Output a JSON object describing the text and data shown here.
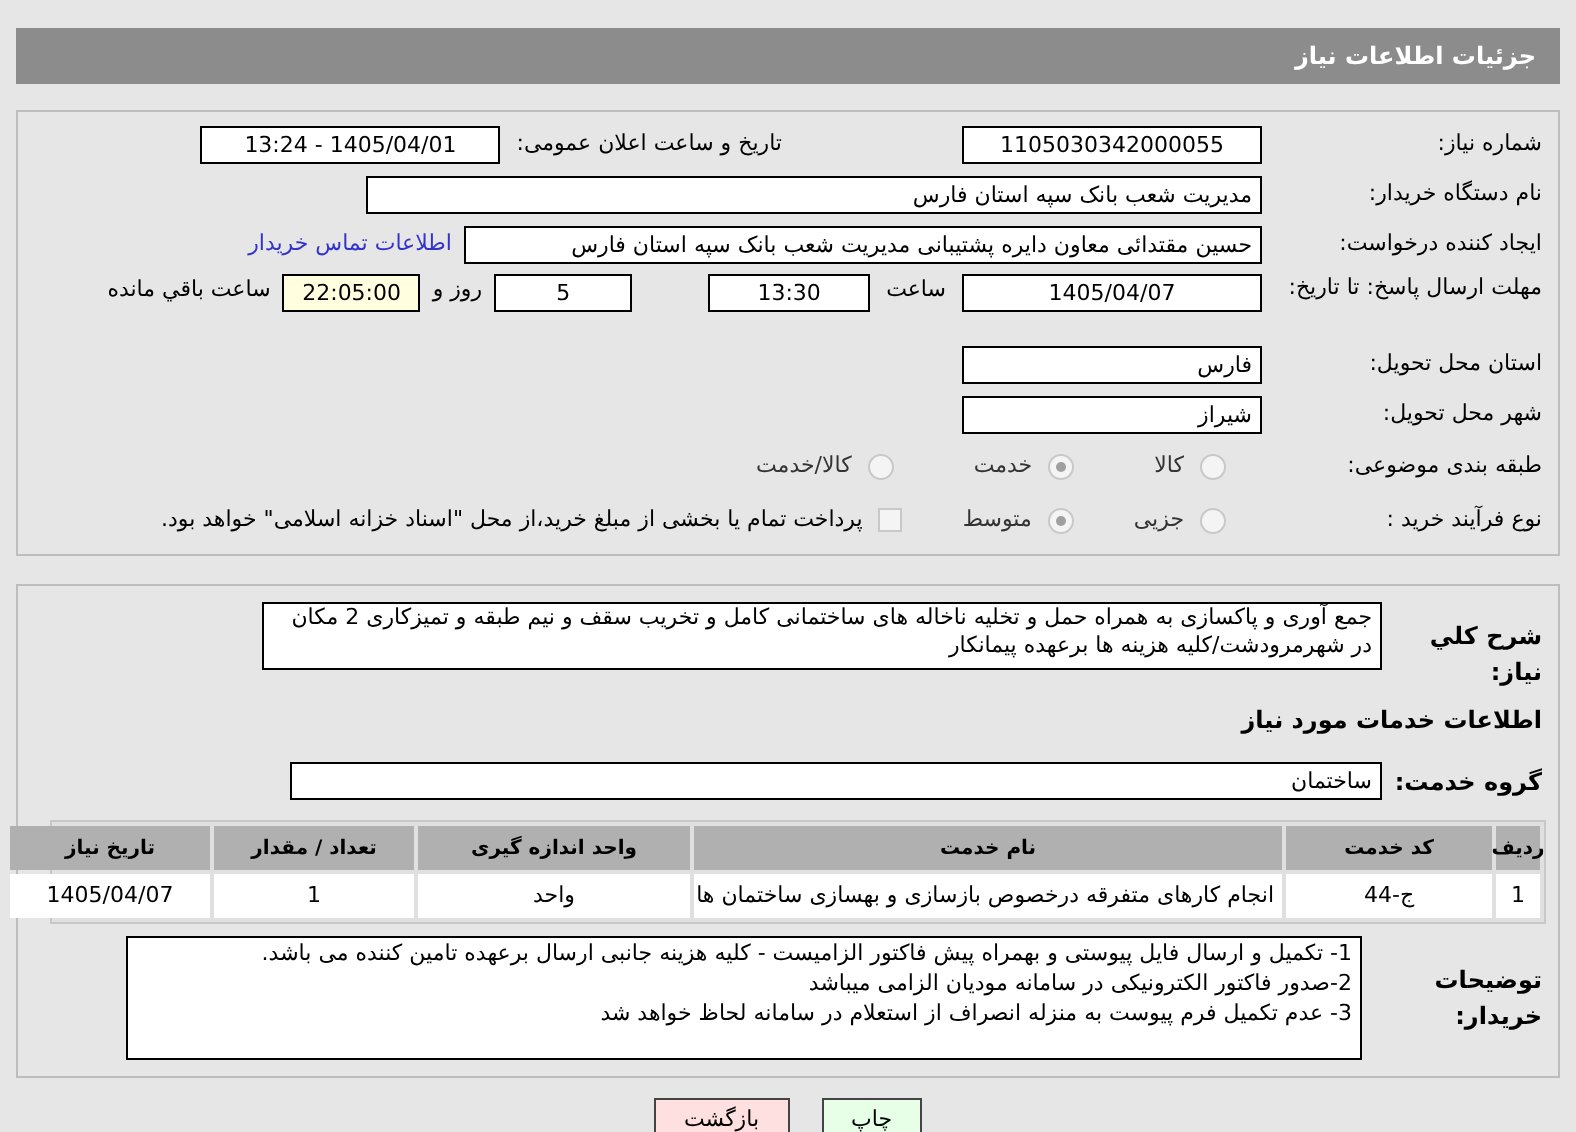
{
  "header": {
    "title": "جزئیات اطلاعات نیاز"
  },
  "need_number": {
    "label": "شماره نیاز:",
    "value": "1105030342000055"
  },
  "announce": {
    "label": "تاریخ و ساعت اعلان عمومی:",
    "value": "1405/04/01 - 13:24"
  },
  "buyer_org": {
    "label": "نام دستگاه خریدار:",
    "value": "مدیریت شعب بانک سپه استان فارس"
  },
  "requester": {
    "label": "ایجاد کننده درخواست:",
    "value": "حسین مقتدائی معاون  دایره پشتیبانی مدیریت شعب بانک سپه استان فارس",
    "link": "اطلاعات تماس خریدار"
  },
  "deadline": {
    "label": "مهلت ارسال پاسخ: تا تاریخ:",
    "date": "1405/04/07",
    "time_label": "ساعت",
    "time": "13:30",
    "days": "5",
    "days_label": "روز و",
    "remaining": "22:05:00",
    "remaining_label": "ساعت باقي مانده"
  },
  "province": {
    "label": "استان محل تحویل:",
    "value": "فارس"
  },
  "city": {
    "label": "شهر محل تحویل:",
    "value": "شیراز"
  },
  "category": {
    "label": "طبقه بندی موضوعی:",
    "options": [
      {
        "label": "کالا",
        "selected": false
      },
      {
        "label": "خدمت",
        "selected": true
      },
      {
        "label": "کالا/خدمت",
        "selected": false
      }
    ]
  },
  "process": {
    "label": "نوع فرآیند خرید :",
    "options": [
      {
        "label": "جزیی",
        "selected": false
      },
      {
        "label": "متوسط",
        "selected": true
      }
    ],
    "treasury": {
      "label": "پرداخت تمام یا بخشی از مبلغ خرید،از محل \"اسناد خزانه اسلامی\" خواهد بود.",
      "checked": false
    }
  },
  "description": {
    "label": "شرح کلي نياز:",
    "value": "جمع آوری و پاکسازی به همراه حمل و تخلیه ناخاله های ساختمانی کامل و تخریب سقف و نیم طبقه و تمیزکاری 2 مکان در شهرمرودشت/کلیه هزینه ها برعهده پیمانکار"
  },
  "services_heading": "اطلاعات خدمات مورد نیاز",
  "service_group": {
    "label": "گروه خدمت:",
    "value": "ساختمان"
  },
  "table": {
    "columns": [
      "ردیف",
      "کد خدمت",
      "نام خدمت",
      "واحد اندازه گیری",
      "تعداد / مقدار",
      "تاریخ نیاز"
    ],
    "rows": [
      [
        "1",
        "ج-44",
        "انجام کارهای متفرقه درخصوص بازسازی و بهسازی ساختمان ها",
        "واحد",
        "1",
        "1405/04/07"
      ]
    ]
  },
  "buyer_notes": {
    "label": "توضیحات خریدار:",
    "lines": [
      "1-  تکمیل و ارسال فایل پیوستی و بهمراه پیش فاکتور الزامیست - کلیه هزینه جانبی ارسال برعهده تامین کننده می باشد.",
      "2-صدور فاکتور الکترونیکی در سامانه مودیان الزامی میباشد",
      "3- عدم تکمیل فرم پیوست به منزله انصراف از استعلام در سامانه لحاظ خواهد شد"
    ]
  },
  "buttons": [
    {
      "kind": "print",
      "label": "چاپ"
    },
    {
      "kind": "back",
      "label": "بازگشت"
    }
  ]
}
